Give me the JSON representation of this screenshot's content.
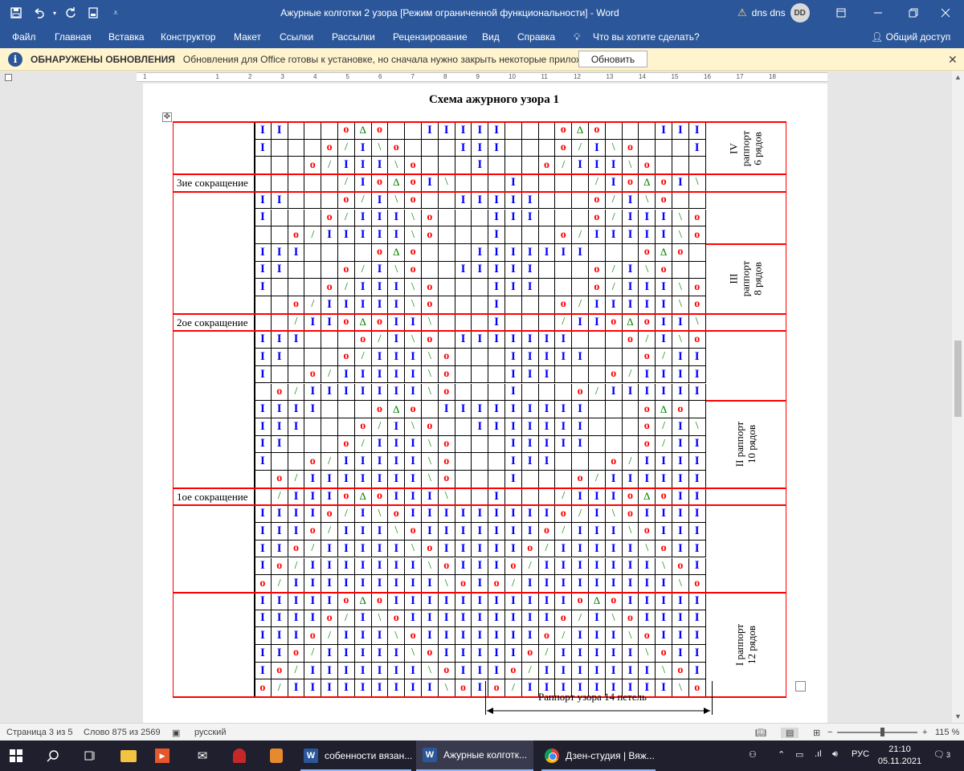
{
  "window": {
    "title": "Ажурные колготки 2 узора [Режим ограниченной функциональности]  -  Word",
    "user_name": "dns dns",
    "user_initials": "DD"
  },
  "ribbon": {
    "tabs": [
      "Файл",
      "Главная",
      "Вставка",
      "Конструктор",
      "Макет",
      "Ссылки",
      "Рассылки",
      "Рецензирование",
      "Вид",
      "Справка"
    ],
    "tell_me": "Что вы хотите сделать?",
    "share": "Общий доступ"
  },
  "notification": {
    "title": "ОБНАРУЖЕНЫ ОБНОВЛЕНИЯ",
    "message": "Обновления для Office готовы к установке, но сначала нужно закрыть некоторые приложения.",
    "button": "Обновить"
  },
  "ruler": {
    "numbers": [
      "1",
      "1",
      "2",
      "3",
      "4",
      "5",
      "6",
      "7",
      "8",
      "9",
      "10",
      "11",
      "12",
      "13",
      "14",
      "15",
      "16",
      "17",
      "18"
    ]
  },
  "document": {
    "title": "Схема ажурного узора 1",
    "rapport_label": "Раппорт узора 14 петель",
    "symbols": {
      "I": "I",
      "o": "o",
      "tri": "Δ",
      "sl": "/",
      "bs": "\\"
    },
    "chart_rows": [
      "II...oΔo..IIIII...oΔo...III",
      "I...o/I\\o...III...o/I\\o...II",
      "...o/III\\o...I...o/III\\o...I",
      "...../Io ΔoI\\...I..../IoΔoI\\...I",
      "II...o/I\\o..IIIII...o/I\\o...III",
      "I...o/III\\o...III...o/III\\o...II",
      "..o/IIIII\\o...I...o/IIIII\\o...I",
      "III....oΔo...IIIIIII...oΔo...III",
      "II...o/I\\o..IIIII...o/I\\o...III",
      "I...o/III\\o...III...o/III\\o...II",
      "..o/IIIII\\o...I...o/IIIII\\o...I",
      "../IIoΔoII\\...I.../IIoΔoII\\...I",
      "III...o/I\\o.IIIIIII...o/I\\o.IIII",
      "II...o/III\\o...IIIII...o/III\\o...III",
      "I..o/IIIII\\o...III...o/IIIII\\o...II",
      ".o/IIIIIII\\o...I...o/IIIIIII\\o...I",
      "IIII...oΔo.IIIIIIIII...oΔo...IIII",
      "III...o/I\\o..IIIIIII...o/I\\o...IIII",
      "II...o/III\\o...IIIII...o/III\\o...III",
      "I..o/IIIII\\o...III...o/IIIII\\o...II",
      ".o/IIIIIII\\o...I...o/IIIIIII\\o...I",
      "./IIIoΔoIII\\..I.../IIIoΔoIII\\...I",
      "IIIIo/I\\oIIIIIIIIIo/I\\oIIII",
      "IIIo/III\\oIIIIIIIo/III\\oIII",
      "IIo/IIIII\\oIIIIIo/IIIII\\oIII",
      "Io/IIIIIII\\oIIIo/IIIIIII\\oII",
      "o/IIIIIIIII\\oIo/IIIIIIIII\\oI",
      "IIIIIoΔoIIIIIIIIIIIoΔoIIIII",
      "IIIIo/I\\oIIIIIIIIIo/I\\oIIII",
      "IIIo/III\\oIIIIIIIo/III\\oIII",
      "IIo/IIIII\\oIIIIIo/IIIII\\oIII",
      "Io/IIIIIII\\oIIIo/IIIIIII\\oII",
      "o/IIIIIIIII\\oIo/IIIIIIIII\\oI"
    ],
    "left_labels": {
      "reduction3": "3ие сокращение",
      "reduction2": "2ое сокращение",
      "reduction1": "1ое сокращение"
    },
    "right_labels": {
      "r4": [
        "IV",
        "раппорт",
        "6 рядов"
      ],
      "r3": [
        "III",
        "раппорт",
        "8 рядов"
      ],
      "r2": [
        "II раппорт",
        "10 рядов"
      ],
      "r1": [
        "I раппорт",
        "12 рядов"
      ]
    }
  },
  "status": {
    "page": "Страница 3 из 5",
    "words": "Слово 875 из 2569",
    "language": "русский",
    "zoom": "115 %"
  },
  "taskbar": {
    "apps": [
      "собенности вязан...",
      "Ажурные колготк...",
      "Дзен-студия | Вяж..."
    ],
    "lang": "РУС",
    "time": "21:10",
    "date": "05.11.2021",
    "notif_count": "3"
  }
}
